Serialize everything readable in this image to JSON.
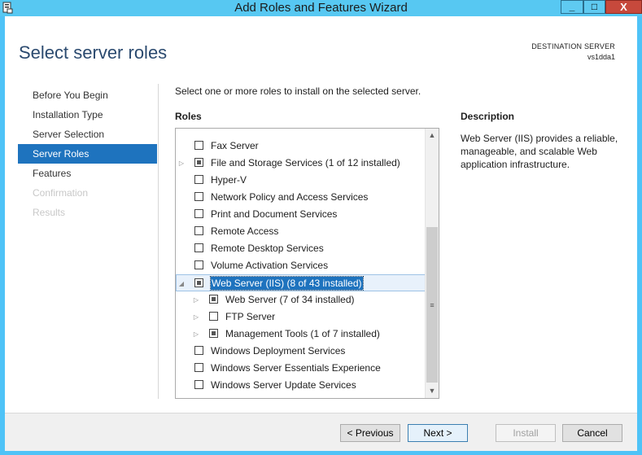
{
  "window": {
    "title": "Add Roles and Features Wizard",
    "min_glyph": "_",
    "max_glyph": "□",
    "close_glyph": "X"
  },
  "header": {
    "page_title": "Select server roles",
    "destination_label": "DESTINATION SERVER",
    "destination_name": "vs1dda1"
  },
  "nav": {
    "items": [
      {
        "label": "Before You Begin",
        "state": "normal"
      },
      {
        "label": "Installation Type",
        "state": "normal"
      },
      {
        "label": "Server Selection",
        "state": "normal"
      },
      {
        "label": "Server Roles",
        "state": "active"
      },
      {
        "label": "Features",
        "state": "normal"
      },
      {
        "label": "Confirmation",
        "state": "disabled"
      },
      {
        "label": "Results",
        "state": "disabled"
      }
    ]
  },
  "main": {
    "instruction": "Select one or more roles to install on the selected server.",
    "roles_heading": "Roles",
    "roles": [
      {
        "label": "Fax Server",
        "checked": "unchecked",
        "expander": ""
      },
      {
        "label": "File and Storage Services (1 of 12 installed)",
        "checked": "partial",
        "expander": "collapsed"
      },
      {
        "label": "Hyper-V",
        "checked": "unchecked",
        "expander": ""
      },
      {
        "label": "Network Policy and Access Services",
        "checked": "unchecked",
        "expander": ""
      },
      {
        "label": "Print and Document Services",
        "checked": "unchecked",
        "expander": ""
      },
      {
        "label": "Remote Access",
        "checked": "unchecked",
        "expander": ""
      },
      {
        "label": "Remote Desktop Services",
        "checked": "unchecked",
        "expander": ""
      },
      {
        "label": "Volume Activation Services",
        "checked": "unchecked",
        "expander": ""
      },
      {
        "label": "Web Server (IIS) (8 of 43 installed)",
        "checked": "partial",
        "expander": "expanded",
        "selected": true
      },
      {
        "label": "Web Server (7 of 34 installed)",
        "checked": "partial",
        "expander": "collapsed",
        "child": true
      },
      {
        "label": "FTP Server",
        "checked": "unchecked",
        "expander": "collapsed",
        "child": true
      },
      {
        "label": "Management Tools (1 of 7 installed)",
        "checked": "partial",
        "expander": "collapsed",
        "child": true
      },
      {
        "label": "Windows Deployment Services",
        "checked": "unchecked",
        "expander": ""
      },
      {
        "label": "Windows Server Essentials Experience",
        "checked": "unchecked",
        "expander": ""
      },
      {
        "label": "Windows Server Update Services",
        "checked": "unchecked",
        "expander": ""
      }
    ]
  },
  "description": {
    "heading": "Description",
    "text": "Web Server (IIS) provides a reliable, manageable, and scalable Web application infrastructure."
  },
  "buttons": {
    "previous": "< Previous",
    "next": "Next >",
    "install": "Install",
    "cancel": "Cancel"
  },
  "colors": {
    "title_bar": "#57c8f2",
    "accent": "#1e73be",
    "page_title": "#2b4a6f",
    "close": "#c7493c"
  }
}
